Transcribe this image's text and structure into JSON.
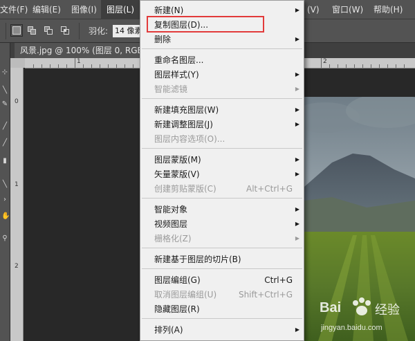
{
  "menubar": {
    "items": [
      {
        "label": "文件(F)"
      },
      {
        "label": "编辑(E)"
      },
      {
        "label": "图像(I)"
      },
      {
        "label": "图层(L)"
      },
      {
        "label": "(V)"
      },
      {
        "label": "窗口(W)"
      },
      {
        "label": "帮助(H)"
      }
    ]
  },
  "options": {
    "feather_label": "羽化:",
    "feather_value": "14 像素"
  },
  "document": {
    "tab_title": "风景.jpg @ 100% (图层 0, RGB/8"
  },
  "ruler": {
    "h_labels": [
      "1",
      "2"
    ],
    "v_labels": [
      "0",
      "1",
      "2"
    ]
  },
  "layer_menu": {
    "items": [
      {
        "label": "新建(N)",
        "shortcut": "",
        "submenu": true,
        "disabled": false
      },
      {
        "label": "复制图层(D)...",
        "shortcut": "",
        "submenu": false,
        "disabled": false
      },
      {
        "label": "删除",
        "shortcut": "",
        "submenu": true,
        "disabled": false
      },
      {
        "label": "重命名图层...",
        "shortcut": "",
        "submenu": false,
        "disabled": false
      },
      {
        "label": "图层样式(Y)",
        "shortcut": "",
        "submenu": true,
        "disabled": false
      },
      {
        "label": "智能滤镜",
        "shortcut": "",
        "submenu": true,
        "disabled": true
      },
      {
        "label": "新建填充图层(W)",
        "shortcut": "",
        "submenu": true,
        "disabled": false
      },
      {
        "label": "新建调整图层(J)",
        "shortcut": "",
        "submenu": true,
        "disabled": false
      },
      {
        "label": "图层内容选项(O)...",
        "shortcut": "",
        "submenu": false,
        "disabled": true
      },
      {
        "label": "图层蒙版(M)",
        "shortcut": "",
        "submenu": true,
        "disabled": false
      },
      {
        "label": "矢量蒙版(V)",
        "shortcut": "",
        "submenu": true,
        "disabled": false
      },
      {
        "label": "创建剪贴蒙版(C)",
        "shortcut": "Alt+Ctrl+G",
        "submenu": false,
        "disabled": true
      },
      {
        "label": "智能对象",
        "shortcut": "",
        "submenu": true,
        "disabled": false
      },
      {
        "label": "视频图层",
        "shortcut": "",
        "submenu": true,
        "disabled": false
      },
      {
        "label": "栅格化(Z)",
        "shortcut": "",
        "submenu": true,
        "disabled": true
      },
      {
        "label": "新建基于图层的切片(B)",
        "shortcut": "",
        "submenu": false,
        "disabled": false
      },
      {
        "label": "图层编组(G)",
        "shortcut": "Ctrl+G",
        "submenu": false,
        "disabled": false
      },
      {
        "label": "取消图层编组(U)",
        "shortcut": "Shift+Ctrl+G",
        "submenu": false,
        "disabled": true
      },
      {
        "label": "隐藏图层(R)",
        "shortcut": "",
        "submenu": false,
        "disabled": false
      },
      {
        "label": "排列(A)",
        "shortcut": "",
        "submenu": true,
        "disabled": false
      }
    ]
  },
  "watermark": {
    "brand": "Bai",
    "brand2": "经验",
    "url": "jingyan.baidu.com"
  },
  "colors": {
    "menu_bg": "#f0f0f0",
    "highlight_border": "#e23a3a",
    "ui_gray": "#535353"
  }
}
